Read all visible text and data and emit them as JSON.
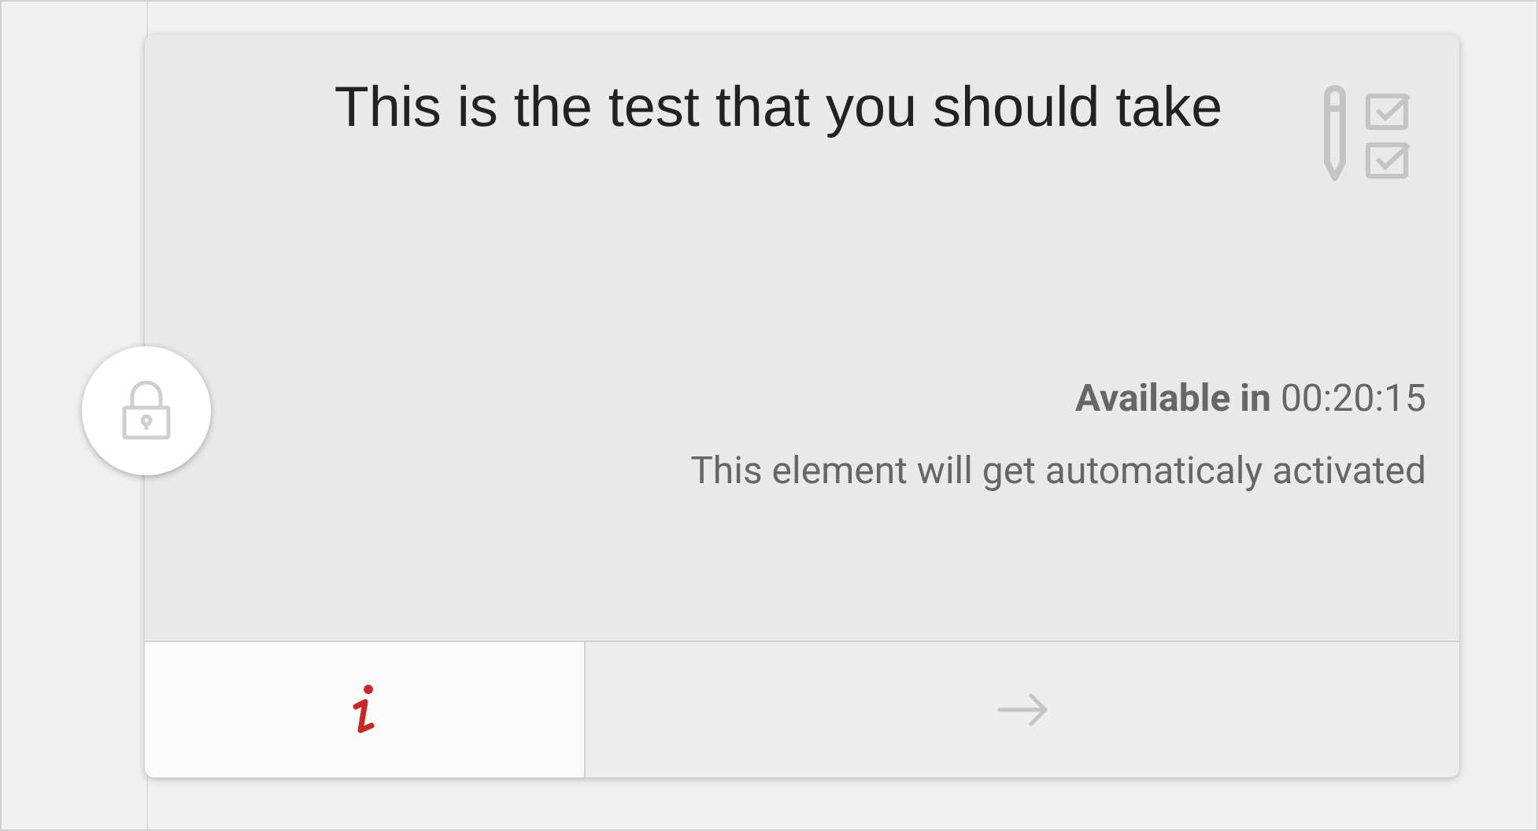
{
  "card": {
    "title": "This is the test that you should take",
    "locked": true,
    "availability": {
      "label": "Available in",
      "time": "00:20:15"
    },
    "note": "This element will get automaticaly activated"
  }
}
